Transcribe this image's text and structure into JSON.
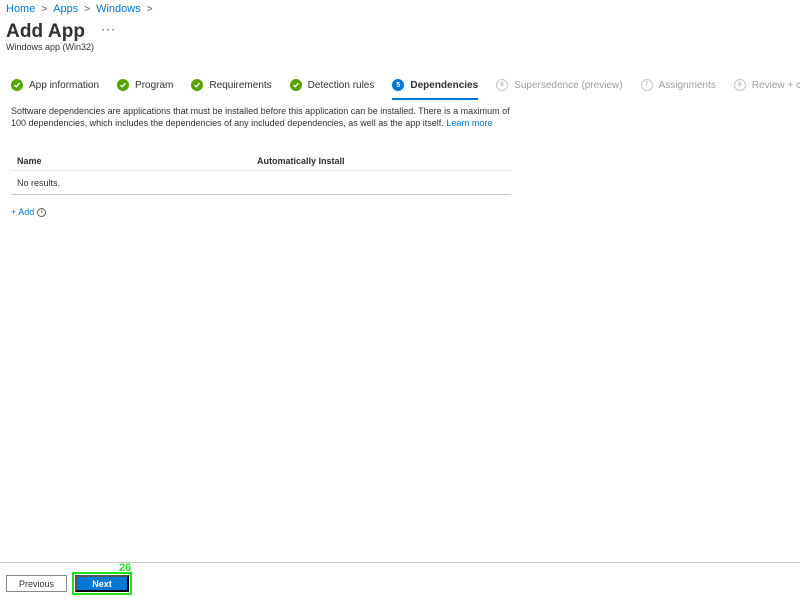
{
  "breadcrumb": [
    "Home",
    "Apps",
    "Windows"
  ],
  "breadcrumb_separator": ">",
  "header": {
    "title": "Add App",
    "more": "···",
    "subtitle": "Windows app (Win32)"
  },
  "steps": [
    {
      "label": "App information",
      "status": "done",
      "marker": ""
    },
    {
      "label": "Program",
      "status": "done",
      "marker": ""
    },
    {
      "label": "Requirements",
      "status": "done",
      "marker": ""
    },
    {
      "label": "Detection rules",
      "status": "done",
      "marker": ""
    },
    {
      "label": "Dependencies",
      "status": "current",
      "marker": "5"
    },
    {
      "label": "Supersedence (preview)",
      "status": "future",
      "marker": "6"
    },
    {
      "label": "Assignments",
      "status": "future",
      "marker": "7"
    },
    {
      "label": "Review + create",
      "status": "future",
      "marker": "8"
    }
  ],
  "description": {
    "text": "Software dependencies are applications that must be installed before this application can be installed. There is a maximum of 100 dependencies, which includes the dependencies of any included dependencies, as well as the app itself.",
    "link": "Learn more"
  },
  "table": {
    "columns": [
      "Name",
      "Automatically Install"
    ],
    "empty": "No results."
  },
  "add": {
    "label": "+ Add",
    "info": "i"
  },
  "footer": {
    "previous": "Previous",
    "next": "Next",
    "marker": "26"
  },
  "colors": {
    "accent": "#0078d4",
    "done": "#57a300",
    "highlight": "#21e01f"
  }
}
